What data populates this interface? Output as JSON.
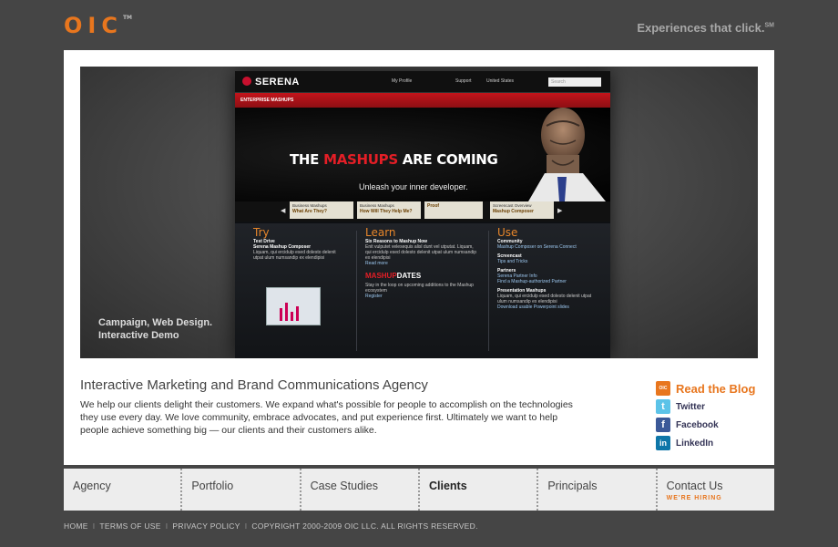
{
  "header": {
    "logo": "OIC",
    "logo_tm": "TM",
    "tagline": "Experiences that click.",
    "tagline_sm": "SM"
  },
  "hero": {
    "caption_line1": "Campaign, Web Design.",
    "caption_line2": "Interactive Demo",
    "site": {
      "brand": "SERENA",
      "nav": [
        "My Profile",
        "Support",
        "United States"
      ],
      "search_placeholder": "Search",
      "bar": "ENTERPRISE MASHUPS",
      "headline_a": "THE ",
      "headline_b": "MASHUPS",
      "headline_c": " ARE COMING",
      "subhead": "Unleash your inner developer.",
      "tabs": [
        {
          "top": "Business Mashups",
          "bottom": "What Are They?"
        },
        {
          "top": "Business Mashups",
          "bottom": "How Will They Help Me?"
        },
        {
          "top": "",
          "bottom": "Proof"
        },
        {
          "top": "Screencast Overview",
          "bottom": "Mashup Composer"
        }
      ],
      "col_try": {
        "heading": "Try",
        "title1": "Test Drive",
        "title2": "Serena Mashup Composer",
        "body": "Liquam, qui ercidulp esed dolesto delenit utpat ulum numsandip ex elendipisi"
      },
      "col_learn": {
        "heading": "Learn",
        "title": "Six Reasons to Mashup Now",
        "body": "Enit vulputet velesequis alisl dunt vel utputat. Liquam, qui ercidulp esed dolesto delenit utpat ulum numsandip ex elendipisi",
        "link1": "Read more",
        "brand_a": "MASHUP",
        "brand_b": "DATES",
        "body2": "Stay in the loop on upcoming additions to the Mashup ecosystem",
        "link2": "Register"
      },
      "col_use": {
        "heading": "Use",
        "t1": "Community",
        "l1": "Mashup Composer on Serena Connect",
        "t2": "Screencast",
        "l2": "Tips and Tricks",
        "t3": "Partners",
        "l3a": "Serena Partner Info",
        "l3b": "Find a Mashup-authorized Partner",
        "t4": "Presentation Mashups",
        "body": "Liquam, qui ercidulp esed dolesto delenit utpat ulum numsandip ex elendipisi",
        "l4": "Download usable Powerpoint slides"
      }
    }
  },
  "intro": {
    "title": "Interactive Marketing and Brand Communications Agency",
    "text": "We help our clients delight their customers. We expand what's possible for people to accomplish on the technologies they use every day. We love community, embrace advocates, and put experience first. Ultimately we want to help people achieve something big — our clients and their customers alike."
  },
  "social": {
    "blog": "Read the Blog",
    "blog_icon": "OIC",
    "twitter": "Twitter",
    "facebook": "Facebook",
    "linkedin": "LinkedIn"
  },
  "nav": {
    "items": [
      "Agency",
      "Portfolio",
      "Case Studies",
      "Clients",
      "Principals",
      "Contact Us"
    ],
    "hiring": "WE'RE HIRING"
  },
  "footer": {
    "home": "HOME",
    "terms": "TERMS OF USE",
    "privacy": "PRIVACY POLICY",
    "copyright": "COPYRIGHT 2000-2009 OIC LLC. ALL RIGHTS RESERVED.",
    "separator": "I"
  },
  "colors": {
    "accent": "#e8761e",
    "background": "#454545",
    "serena_red": "#c3141b"
  }
}
